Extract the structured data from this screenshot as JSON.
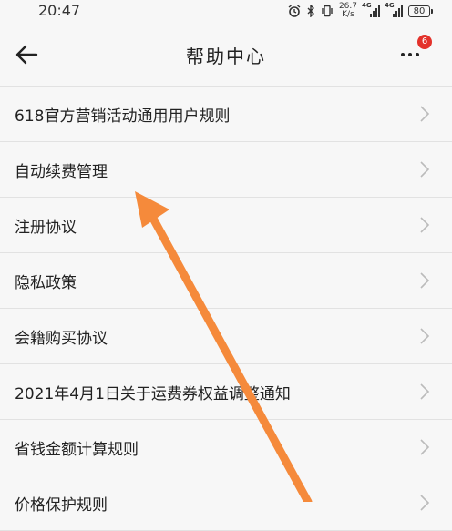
{
  "status_bar": {
    "time": "20:47",
    "speed_value": "26.7",
    "speed_unit": "K/s",
    "battery": "80",
    "net_tag_1": "4G",
    "net_tag_2": "4G"
  },
  "header": {
    "title": "帮助中心",
    "badge_count": "6"
  },
  "items": [
    {
      "label": "618官方营销活动通用用户规则"
    },
    {
      "label": "自动续费管理"
    },
    {
      "label": "注册协议"
    },
    {
      "label": "隐私政策"
    },
    {
      "label": "会籍购买协议"
    },
    {
      "label": "2021年4月1日关于运费券权益调整通知"
    },
    {
      "label": "省钱金额计算规则"
    },
    {
      "label": "价格保护规则"
    }
  ],
  "annotation": {
    "arrow_color": "#f58a3b"
  },
  "icons": [
    "back-arrow-icon",
    "more-dots-icon",
    "chevron-right-icon",
    "alarm-icon",
    "bluetooth-icon",
    "vibrate-icon",
    "signal-icon",
    "battery-icon"
  ]
}
